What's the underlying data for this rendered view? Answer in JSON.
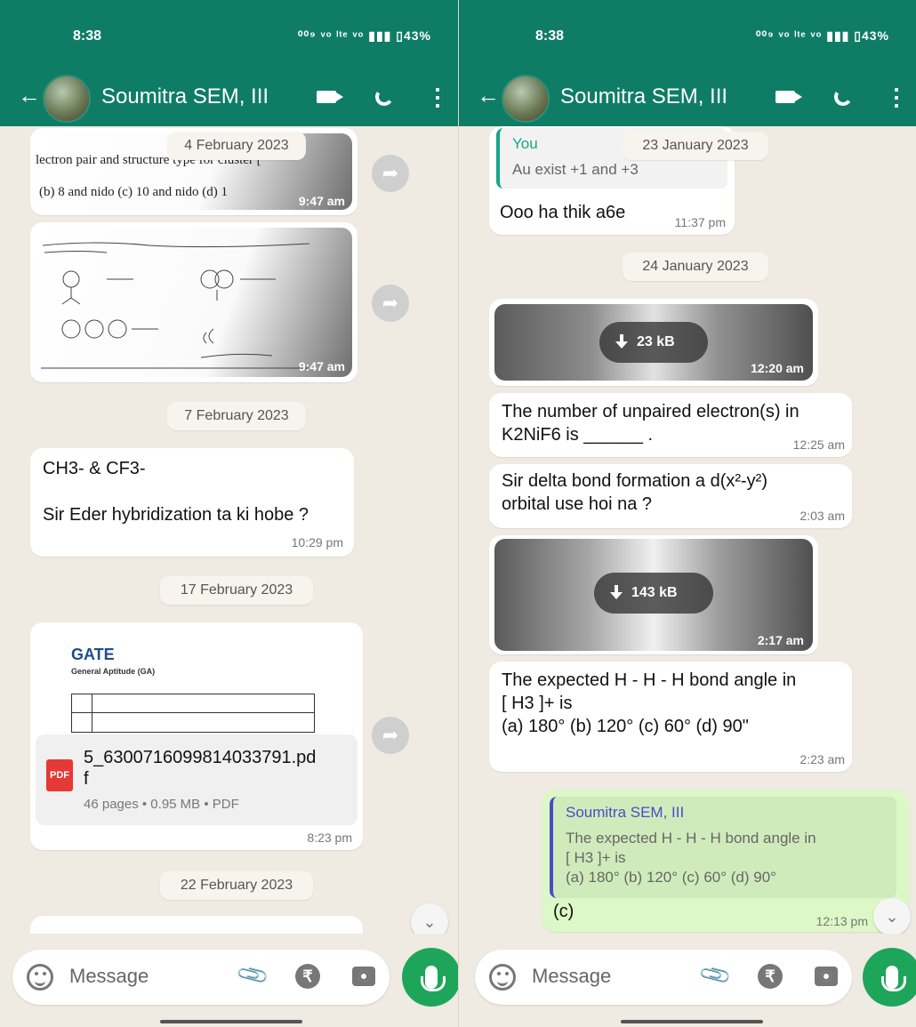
{
  "left": {
    "status": {
      "time": "8:38",
      "icons": "⁰⁰⁹ ᵛᵒ ˡᵗᵉ ᵛᵒ ▮▮▮ ▯43%"
    },
    "header": {
      "back": "←",
      "contact": "Soumitra SEM, III",
      "more": "⋮"
    },
    "chat": {
      "date_feb4": "4 February 2023",
      "img1_line1": "lectron pair and structure type for cluster [",
      "img1_line2": "(b) 8 and nido           (c) 10 and nido     (d) 1",
      "img1_time": "9:47 am",
      "img2_time": "9:47 am",
      "date_feb7": "7 February 2023",
      "msg1_text": "CH3- & CF3-\n\nSir Eder hybridization ta ki hobe ?",
      "msg1_time": "10:29 pm",
      "date_feb17": "17 February 2023",
      "doc_gate": "GATE",
      "doc_subtitle": "General Aptitude (GA)",
      "doc_filename": "5_6300716099814033791.pd\nf",
      "doc_meta": "46 pages • 0.95 MB • PDF",
      "doc_time": "8:23 pm",
      "date_feb22": "22 February 2023"
    },
    "input": {
      "placeholder": "Message"
    }
  },
  "right": {
    "status": {
      "time": "8:38",
      "icons": "⁰⁰⁹ ᵛᵒ ˡᵗᵉ ᵛᵒ ▮▮▮ ▯43%"
    },
    "header": {
      "back": "←",
      "contact": "Soumitra SEM, III",
      "more": "⋮"
    },
    "chat": {
      "quote_you_name": "You",
      "quote_you_text": "Au exist +1 and +3",
      "date_jan23": "23 January 2023",
      "reply1_text": "Ooo ha thik a6e",
      "reply1_time": "11:37 pm",
      "date_jan24": "24 January 2023",
      "media1_size": "23 kB",
      "media1_time": "12:20 am",
      "msg2_text": "The number of unpaired electron(s) in\nK2NiF6 is ______ .",
      "msg2_time": "12:25 am",
      "msg3_text": "Sir delta bond formation a d(x²-y²)\norbital use hoi na ?",
      "msg3_time": "2:03 am",
      "media2_size": "143 kB",
      "media2_time": "2:17 am",
      "msg4_text": "The expected H - H - H bond angle in\n[ H3 ]+ is\n(a) 180° (b) 120° (c) 60° (d) 90\"",
      "msg4_time": "2:23 am",
      "out_quote_name": "Soumitra SEM, III",
      "out_quote_text": "The expected H - H - H bond angle in\n[ H3 ]+ is\n(a) 180° (b) 120° (c) 60° (d) 90°",
      "out_text": "(c)",
      "out_time": "12:13 pm"
    },
    "input": {
      "placeholder": "Message"
    }
  }
}
